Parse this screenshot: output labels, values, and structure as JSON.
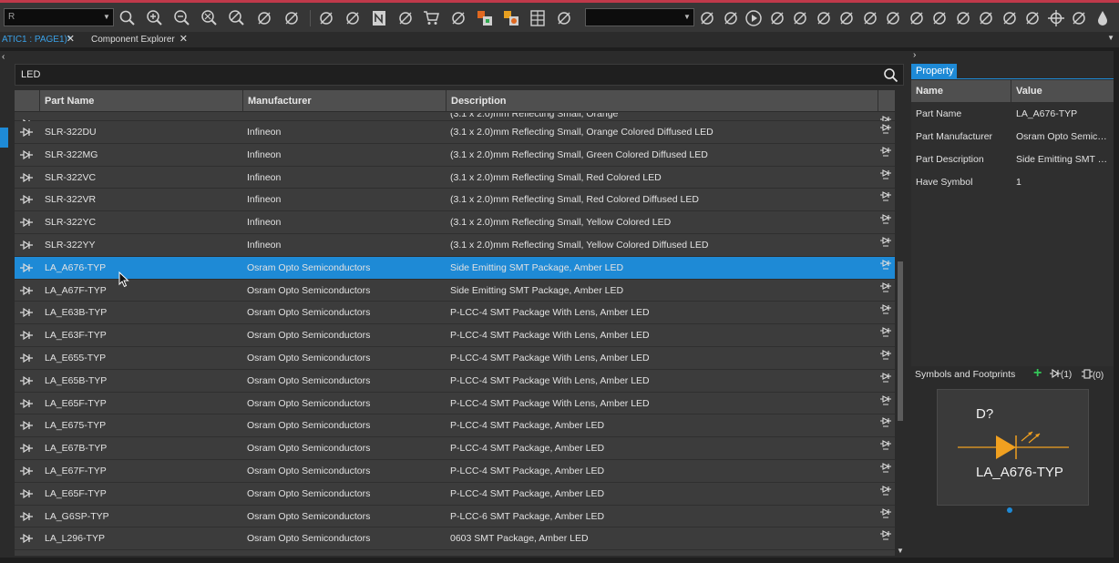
{
  "toolbar": {
    "combo1_value": "R",
    "combo2_value": "",
    "icons_group1": [
      "search-icon",
      "zoom-in-icon",
      "zoom-out-icon",
      "zoom-fit-icon",
      "zoom-area-icon",
      "pan-icon",
      "component-icon"
    ],
    "icons_group2": [
      "net-icon",
      "netlist-icon",
      "note-icon",
      "doc-icon",
      "cart-icon",
      "matrix-icon",
      "bom-icon",
      "bom2-icon",
      "table-icon",
      "check-icon"
    ],
    "icons_group3": [
      "wire-icon",
      "bus-icon",
      "play-icon",
      "junction-icon",
      "part-icon",
      "probe-icon",
      "probe2-icon",
      "probe3-icon",
      "probe4-icon",
      "probe5-icon",
      "vd-icon",
      "cd-icon",
      "pb-icon",
      "measure-icon",
      "tree-icon",
      "crosshair-icon",
      "gnd-icon",
      "drop-icon"
    ]
  },
  "tabs": [
    {
      "label": "ATIC1 : PAGE1)*",
      "active": true
    },
    {
      "label": "Component Explorer",
      "active": false
    }
  ],
  "search": {
    "value": "LED"
  },
  "table": {
    "headers": [
      "Part Name",
      "Manufacturer",
      "Description"
    ],
    "partial_row": {
      "name": "",
      "manufacturer": "",
      "description": "(3.1 x 2.0)mm Reflecting Small, Orange"
    },
    "rows": [
      {
        "name": "SLR-322DU",
        "manufacturer": "Infineon",
        "description": "(3.1 x 2.0)mm Reflecting Small, Orange Colored Diffused LED"
      },
      {
        "name": "SLR-322MG",
        "manufacturer": "Infineon",
        "description": "(3.1 x 2.0)mm Reflecting Small, Green Colored Diffused LED"
      },
      {
        "name": "SLR-322VC",
        "manufacturer": "Infineon",
        "description": "(3.1 x 2.0)mm Reflecting Small, Red Colored LED"
      },
      {
        "name": "SLR-322VR",
        "manufacturer": "Infineon",
        "description": "(3.1 x 2.0)mm Reflecting Small, Red Colored Diffused LED"
      },
      {
        "name": "SLR-322YC",
        "manufacturer": "Infineon",
        "description": "(3.1 x 2.0)mm Reflecting Small, Yellow Colored LED"
      },
      {
        "name": "SLR-322YY",
        "manufacturer": "Infineon",
        "description": "(3.1 x 2.0)mm Reflecting Small, Yellow Colored Diffused LED"
      },
      {
        "name": "LA_A676-TYP",
        "manufacturer": "Osram Opto Semiconductors",
        "description": "Side Emitting SMT Package, Amber LED",
        "selected": true
      },
      {
        "name": "LA_A67F-TYP",
        "manufacturer": "Osram Opto Semiconductors",
        "description": "Side Emitting SMT Package, Amber LED"
      },
      {
        "name": "LA_E63B-TYP",
        "manufacturer": "Osram Opto Semiconductors",
        "description": "P-LCC-4 SMT Package With Lens, Amber LED"
      },
      {
        "name": "LA_E63F-TYP",
        "manufacturer": "Osram Opto Semiconductors",
        "description": "P-LCC-4 SMT Package With Lens, Amber LED"
      },
      {
        "name": "LA_E655-TYP",
        "manufacturer": "Osram Opto Semiconductors",
        "description": "P-LCC-4 SMT Package With Lens, Amber LED"
      },
      {
        "name": "LA_E65B-TYP",
        "manufacturer": "Osram Opto Semiconductors",
        "description": "P-LCC-4 SMT Package With Lens, Amber LED"
      },
      {
        "name": "LA_E65F-TYP",
        "manufacturer": "Osram Opto Semiconductors",
        "description": "P-LCC-4 SMT Package With Lens, Amber LED"
      },
      {
        "name": "LA_E675-TYP",
        "manufacturer": "Osram Opto Semiconductors",
        "description": "P-LCC-4 SMT Package, Amber LED"
      },
      {
        "name": "LA_E67B-TYP",
        "manufacturer": "Osram Opto Semiconductors",
        "description": "P-LCC-4 SMT Package, Amber LED"
      },
      {
        "name": "LA_E67F-TYP",
        "manufacturer": "Osram Opto Semiconductors",
        "description": "P-LCC-4 SMT Package, Amber LED"
      },
      {
        "name": "LA_E65F-TYP",
        "manufacturer": "Osram Opto Semiconductors",
        "description": "P-LCC-4 SMT Package, Amber LED"
      },
      {
        "name": "LA_G6SP-TYP",
        "manufacturer": "Osram Opto Semiconductors",
        "description": "P-LCC-6 SMT Package, Amber LED"
      },
      {
        "name": "LA_L296-TYP",
        "manufacturer": "Osram Opto Semiconductors",
        "description": "0603 SMT Package, Amber LED"
      }
    ]
  },
  "property_panel": {
    "tab_label": "Property",
    "headers": {
      "name": "Name",
      "value": "Value"
    },
    "rows": [
      {
        "name": "Part Name",
        "value": "LA_A676-TYP"
      },
      {
        "name": "Part Manufacturer",
        "value": "Osram Opto Semicon..."
      },
      {
        "name": "Part Description",
        "value": "Side Emitting SMT Pac..."
      },
      {
        "name": "Have Symbol",
        "value": "1"
      }
    ]
  },
  "symbols": {
    "title": "Symbols and Footprints",
    "add": "+",
    "symbol_count": "(1)",
    "footprint_count": "(0)",
    "ref": "D?",
    "part_name": "LA_A676-TYP"
  },
  "colors": {
    "accent": "#1e8ad6",
    "led_fill": "#f0a020",
    "add_green": "#34c759",
    "top_stripe": "#c0394a"
  }
}
